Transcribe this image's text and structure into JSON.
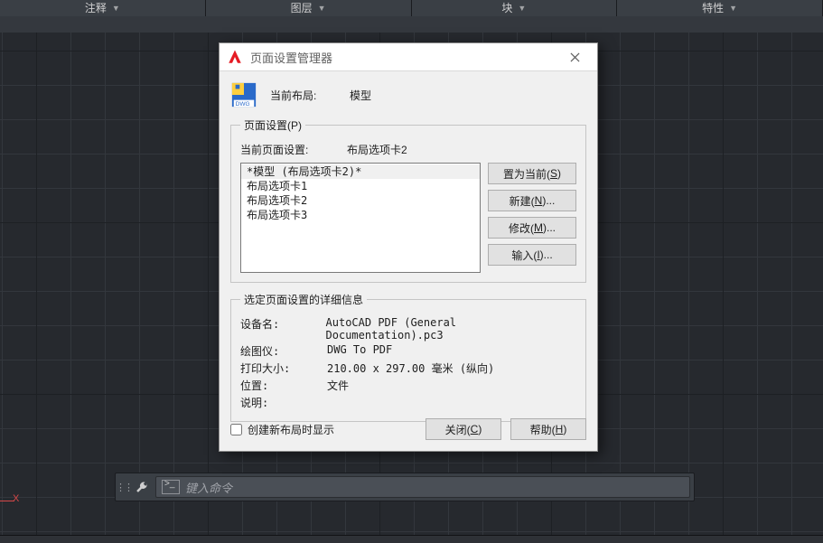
{
  "ribbon": {
    "tabs": [
      "注释",
      "图层",
      "块",
      "特性"
    ]
  },
  "command_bar": {
    "placeholder": "键入命令"
  },
  "crosshair_label": "X",
  "dialog": {
    "title": "页面设置管理器",
    "current_layout_label": "当前布局:",
    "current_layout_value": "模型",
    "page_setup_group": "页面设置(P)",
    "current_ps_label": "当前页面设置:",
    "current_ps_value": "布局选项卡2",
    "list": [
      "*模型 (布局选项卡2)*",
      "布局选项卡1",
      "布局选项卡2",
      "布局选项卡3"
    ],
    "selected_index": 0,
    "buttons": {
      "set_current": "置为当前(S)",
      "new": "新建(N)...",
      "modify": "修改(M)...",
      "import": "输入(I)..."
    },
    "details_group": "选定页面设置的详细信息",
    "details": {
      "device_label": "设备名:",
      "device_value": "AutoCAD PDF (General Documentation).pc3",
      "plotter_label": "绘图仪:",
      "plotter_value": "DWG To PDF",
      "size_label": "打印大小:",
      "size_value": "210.00 x 297.00 毫米 (纵向)",
      "where_label": "位置:",
      "where_value": "文件",
      "desc_label": "说明:",
      "desc_value": ""
    },
    "checkbox_label": "创建新布局时显示",
    "close_btn": "关闭(C)",
    "help_btn": "帮助(H)"
  }
}
